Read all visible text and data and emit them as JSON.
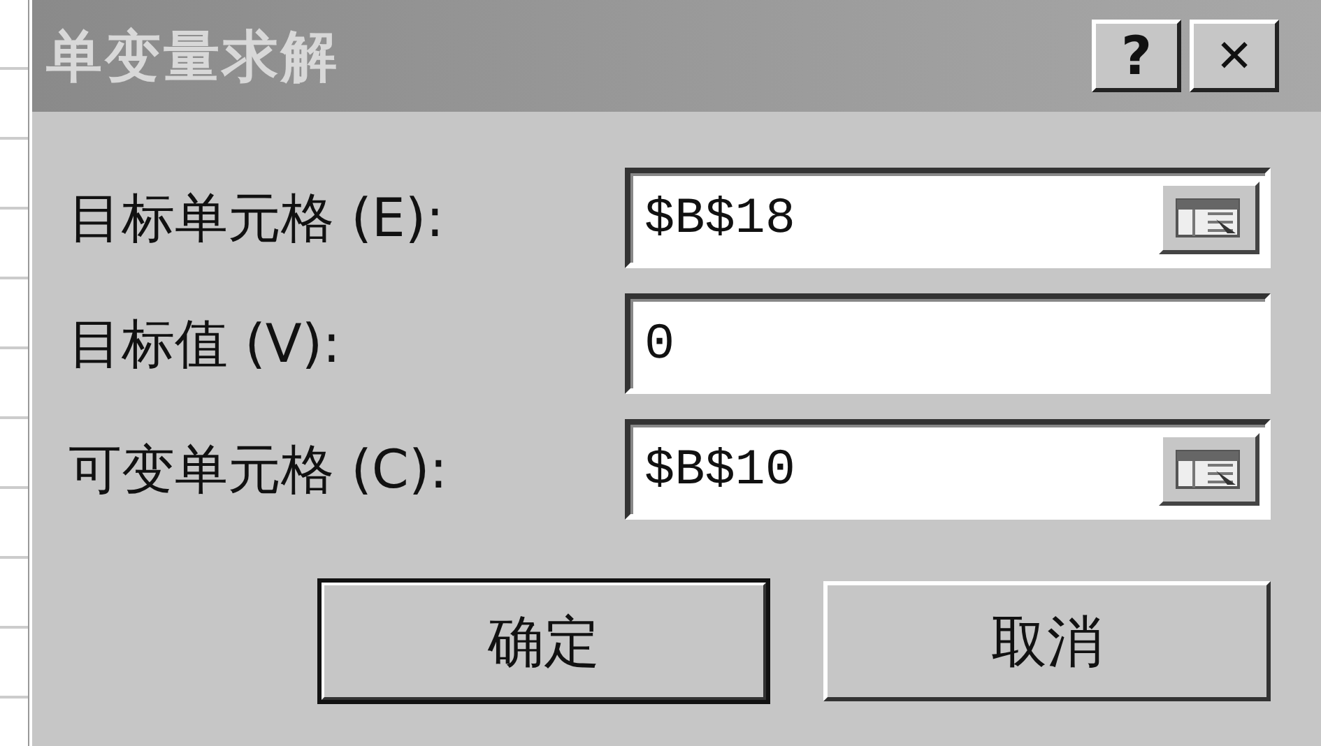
{
  "window": {
    "title": "单变量求解",
    "title_buttons": [
      {
        "kind": "help",
        "label": "?"
      },
      {
        "kind": "close",
        "label": "✕"
      }
    ]
  },
  "fields": [
    {
      "label": "目标单元格 (E):",
      "value": "$B$18",
      "ref_button": true
    },
    {
      "label": "目标值 (V):",
      "value": "0",
      "ref_button": false
    },
    {
      "label": "可变单元格 (C):",
      "value": "$B$10",
      "ref_button": true
    }
  ],
  "buttons": [
    {
      "label": "确定",
      "default": true
    },
    {
      "label": "取消",
      "default": false
    }
  ]
}
